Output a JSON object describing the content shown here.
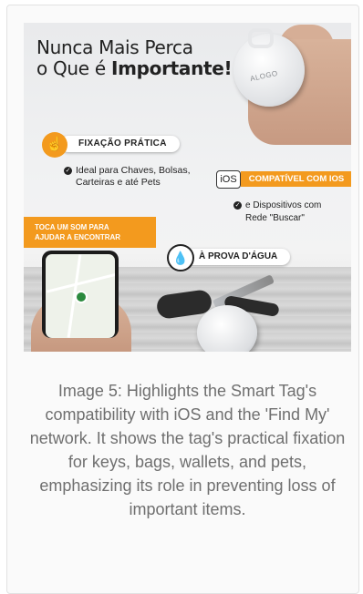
{
  "promo": {
    "headline_line1": "Nunca Mais Perca",
    "headline_line2_prefix": "o Que é ",
    "headline_line2_bold": "Importante!",
    "tag_logo": "ALOGO",
    "feature_fix": {
      "badge_icon": "hand-tap-icon",
      "label": "FIXAÇÃO PRÁTICA",
      "text_line1": "Ideal para Chaves, Bolsas,",
      "text_line2": "Carteiras e até Pets"
    },
    "feature_ios": {
      "icon_text": "iOS",
      "label": "COMPATÍVEL COM IOS",
      "text_line1": "e Dispositivos com",
      "text_line2": "Rede \"Buscar\""
    },
    "feature_sound": {
      "label_line1": "TOCA UM SOM PARA",
      "label_line2": "AJUDAR A ENCONTRAR"
    },
    "feature_water": {
      "icon": "water-drop-icon",
      "label": "À PROVA D'ÁGUA"
    },
    "colors": {
      "accent": "#f39a1e",
      "text": "#222222"
    }
  },
  "caption": "Image 5: Highlights the Smart Tag's compatibility with iOS and the 'Find My' network. It shows the tag's practical fixation for keys, bags, wallets, and pets, emphasizing its role in preventing loss of important items."
}
